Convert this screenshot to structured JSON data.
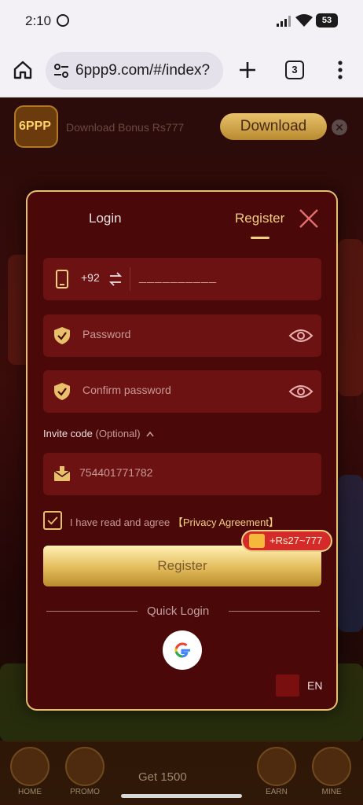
{
  "status_bar": {
    "time": "2:10",
    "battery": "53"
  },
  "browser": {
    "url": "6ppp9.com/#/index?",
    "tab_count": "3"
  },
  "download_bar": {
    "logo": "6PPP",
    "bonus_text": "Download Bonus Rs777",
    "download_label": "Download"
  },
  "modal": {
    "tabs": {
      "login": "Login",
      "register": "Register",
      "active": "Register"
    },
    "phone": {
      "country_code": "+92",
      "placeholder": "__________"
    },
    "password_placeholder": "Password",
    "confirm_password_placeholder": "Confirm password",
    "invite": {
      "label": "Invite code",
      "optional": "(Optional)",
      "value": "754401771782"
    },
    "agreement": {
      "checked": true,
      "text": "I have read and agree ",
      "link": "【Privacy Agreement】"
    },
    "bonus_tag": "+Rs27~777",
    "register_button": "Register",
    "quick_login": "Quick Login",
    "language": "EN"
  },
  "bottom_nav": {
    "home": "HOME",
    "promo": "PROMO",
    "center": "Get 1500",
    "earn": "EARN",
    "mine": "MINE"
  },
  "colors": {
    "modal_bg": "#4a0808",
    "field_bg": "#6d1212",
    "gold": "#e8bf6a",
    "accent": "#f1cf83"
  }
}
